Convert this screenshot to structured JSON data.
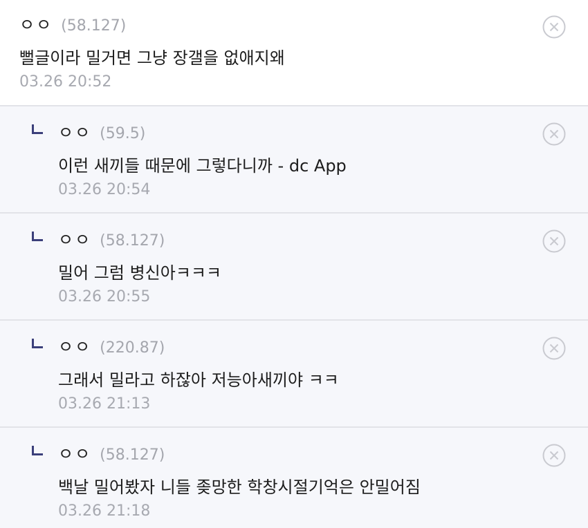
{
  "comments": [
    {
      "nickname": "ㅇㅇ",
      "ip": "(58.127)",
      "text": "뻘글이라 밀거면 그냥 장갤을 없애지왜",
      "time": "03.26 20:52"
    },
    {
      "nickname": "ㅇㅇ",
      "ip": "(59.5)",
      "text": "이런 새끼들 때문에 그렇다니까 - dc App",
      "time": "03.26 20:54"
    },
    {
      "nickname": "ㅇㅇ",
      "ip": "(58.127)",
      "text": "밀어 그럼 병신아ㅋㅋㅋ",
      "time": "03.26 20:55"
    },
    {
      "nickname": "ㅇㅇ",
      "ip": "(220.87)",
      "text": "그래서 밀라고 하잖아 저능아새끼야 ㅋㅋ",
      "time": "03.26 21:13"
    },
    {
      "nickname": "ㅇㅇ",
      "ip": "(58.127)",
      "text": "백날 밀어봤자 니들 좆망한 학창시절기억은 안밀어짐",
      "time": "03.26 21:18"
    }
  ],
  "icons": {
    "delete": "close-circle-icon",
    "reply": "reply-corner-icon"
  },
  "colors": {
    "reply_background": "#f6f7fb",
    "reply_marker": "#3b3f7a",
    "meta_text": "#a4a6ad",
    "divider": "#e2e3e8"
  }
}
